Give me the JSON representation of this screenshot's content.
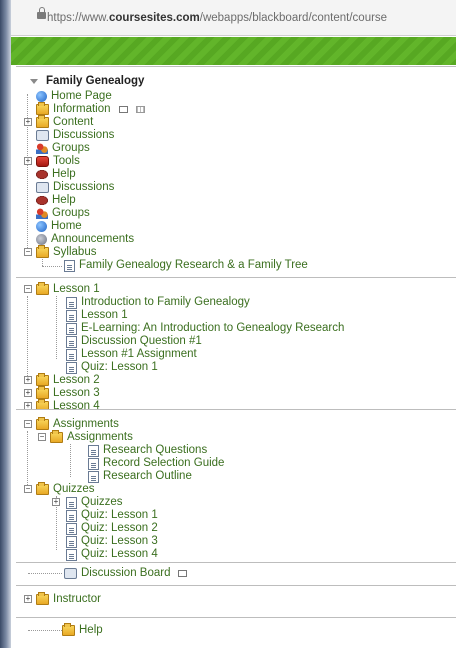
{
  "browser": {
    "url_prefix": "https://www.",
    "url_domain": "coursesites.com",
    "url_path": "/webapps/blackboard/content/course"
  },
  "course": {
    "title": "Family Genealogy",
    "items": [
      {
        "label": "Home Page",
        "icon": "globe-icon"
      },
      {
        "label": "Information",
        "icon": "folder-icon"
      },
      {
        "label": "Content",
        "icon": "folder-icon"
      },
      {
        "label": "Discussions",
        "icon": "discussion-icon"
      },
      {
        "label": "Groups",
        "icon": "groups-icon"
      },
      {
        "label": "Tools",
        "icon": "tools-icon"
      },
      {
        "label": "Help",
        "icon": "help-icon"
      },
      {
        "label": "Discussions",
        "icon": "discussion-icon"
      },
      {
        "label": "Help",
        "icon": "help-icon"
      },
      {
        "label": "Groups",
        "icon": "groups-icon"
      },
      {
        "label": "Home",
        "icon": "globe-icon"
      },
      {
        "label": "Announcements",
        "icon": "announcements-icon"
      },
      {
        "label": "Syllabus",
        "icon": "folder-icon"
      }
    ],
    "syllabus_child": "Family Genealogy Research & a Family Tree"
  },
  "lessons": {
    "lesson1": "Lesson 1",
    "children": [
      "Introduction to Family Genealogy",
      "Lesson 1",
      "E-Learning: An Introduction to Genealogy Research",
      "Discussion Question #1",
      "Lesson #1 Assignment",
      "Quiz: Lesson 1"
    ],
    "lesson2": "Lesson 2",
    "lesson3": "Lesson 3",
    "lesson4": "Lesson 4"
  },
  "assignments": {
    "top": "Assignments",
    "sub": "Assignments",
    "children": [
      "Research Questions",
      "Record Selection Guide",
      "Research Outline"
    ],
    "quizzes": "Quizzes",
    "quizzes_sub": "Quizzes",
    "quiz_items": [
      "Quiz: Lesson 1",
      "Quiz: Lesson 2",
      "Quiz: Lesson 3",
      "Quiz: Lesson 4"
    ]
  },
  "discussion_board": "Discussion Board",
  "instructor": "Instructor",
  "help": "Help"
}
